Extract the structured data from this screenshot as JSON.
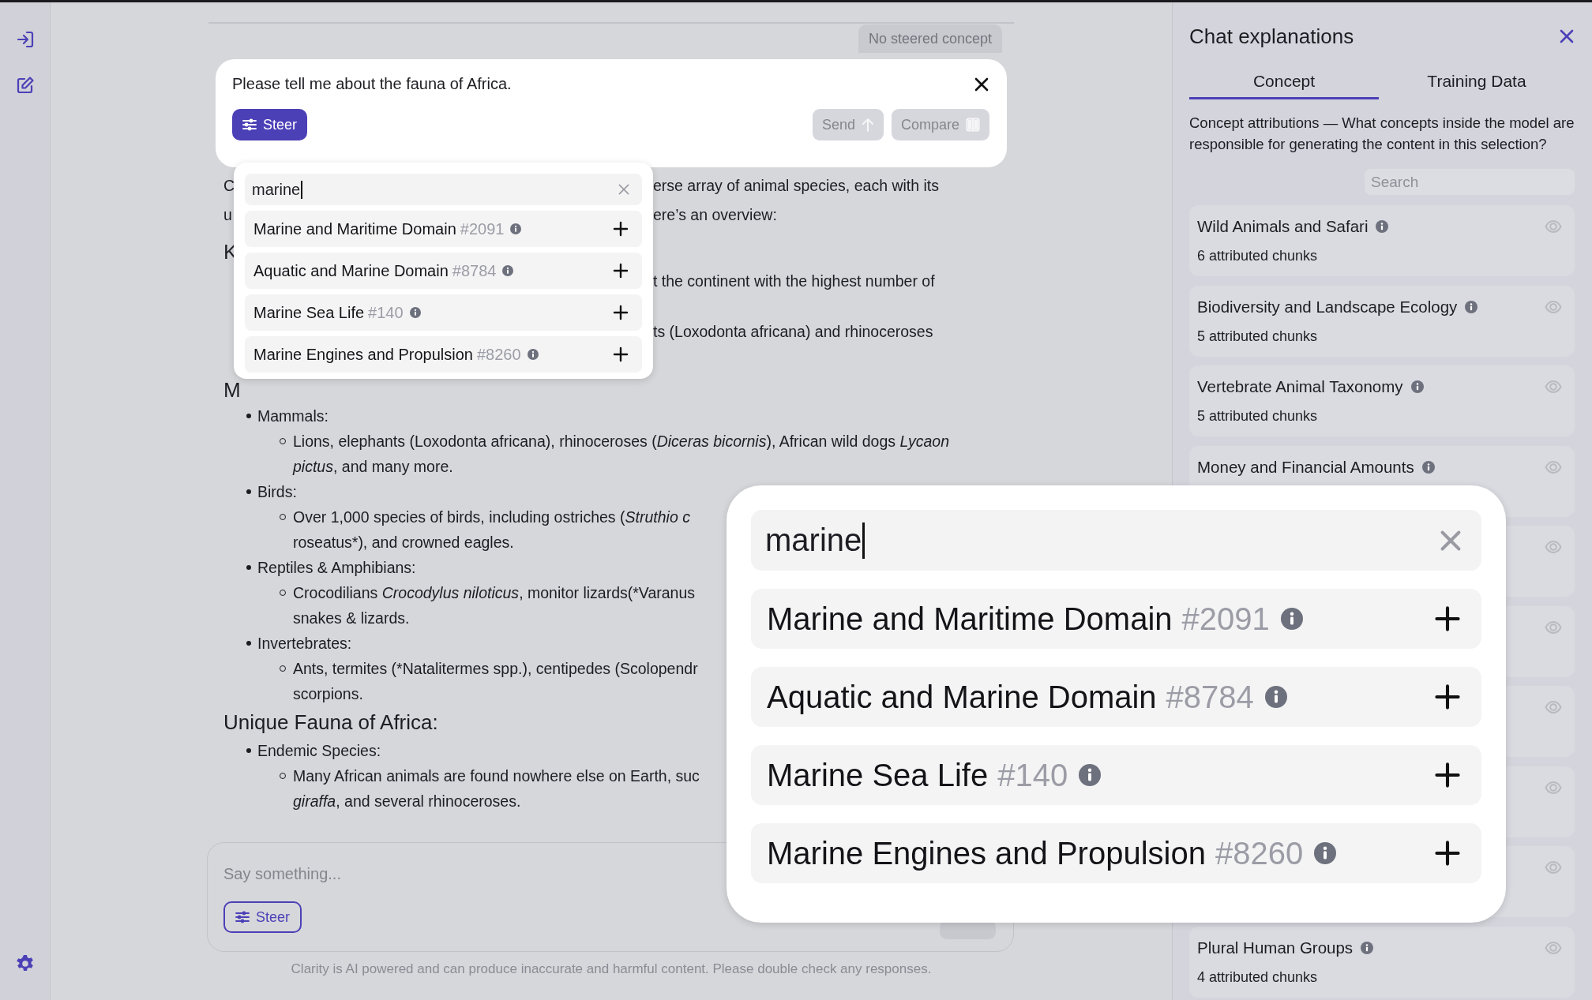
{
  "chat": {
    "steer_status": "No steered concept",
    "prompt": {
      "text": "Please tell me about the fauna of Africa.",
      "steer": {
        "label": "Steer",
        "active": true
      },
      "buttons": [
        {
          "label": "Send",
          "kind": "send",
          "disabled": true
        },
        {
          "label": "Compare",
          "kind": "compare",
          "disabled": true
        }
      ]
    },
    "steer_menu": {
      "query": "marine",
      "results": [
        {
          "name": "Marine and Maritime Domain",
          "id": "#2091"
        },
        {
          "name": "Aquatic and Marine Domain",
          "id": "#8784"
        },
        {
          "name": "Marine Sea Life",
          "id": "#140"
        },
        {
          "name": "Marine Engines and Propulsion",
          "id": "#8260"
        }
      ]
    },
    "response": {
      "fragments": [
        {
          "kind": "text",
          "left": "C",
          "right": "erse array of animal species, each with its"
        },
        {
          "kind": "text",
          "left": "u",
          "right": "ere’s an overview:"
        },
        {
          "kind": "heading",
          "left": "K"
        },
        {
          "kind": "text",
          "right": "t the continent with the highest number of"
        },
        {
          "kind": "text",
          "right": "ts (Loxodonta africana) and rhinoceroses"
        },
        {
          "kind": "heading",
          "left": "M"
        }
      ],
      "sections": [
        {
          "items": [
            {
              "label": "Mammals:",
              "subs": [
                {
                  "lines": [
                    [
                      {
                        "t": "Lions, elephants (Loxodonta africana), rhinoceroses ("
                      },
                      {
                        "t": "Diceras bicornis",
                        "italic": true
                      },
                      {
                        "t": "), African wild dogs "
                      },
                      {
                        "t": "Lycaon",
                        "italic": true
                      }
                    ],
                    [
                      {
                        "t": "pictus",
                        "italic": true
                      },
                      {
                        "t": ", and many more."
                      }
                    ]
                  ]
                }
              ]
            },
            {
              "label": "Birds:",
              "subs": [
                {
                  "lines": [
                    [
                      {
                        "t": "Over 1,000 species of birds, including ostriches ("
                      },
                      {
                        "t": "Struthio c",
                        "italic": true
                      }
                    ],
                    [
                      {
                        "t": "roseatus*), and crowned eagles."
                      }
                    ]
                  ]
                }
              ]
            },
            {
              "label": "Reptiles & Amphibians:",
              "subs": [
                {
                  "lines": [
                    [
                      {
                        "t": "Crocodilians "
                      },
                      {
                        "t": "Crocodylus niloticus",
                        "italic": true
                      },
                      {
                        "t": ", monitor lizards(*Varanus"
                      }
                    ],
                    [
                      {
                        "t": "snakes & lizards."
                      }
                    ]
                  ]
                }
              ]
            },
            {
              "label": "Invertebrates:",
              "subs": [
                {
                  "lines": [
                    [
                      {
                        "t": "Ants, termites (*Natalitermes spp.), centipedes (Scolopendr"
                      }
                    ],
                    [
                      {
                        "t": "scorpions."
                      }
                    ]
                  ]
                }
              ]
            }
          ]
        },
        {
          "heading": "Unique Fauna of Africa:",
          "items": [
            {
              "label": "Endemic Species:",
              "subs": [
                {
                  "lines": [
                    [
                      {
                        "t": "Many African animals are found nowhere else on Earth, suc"
                      }
                    ],
                    [
                      {
                        "t": "giraffa",
                        "italic": true
                      },
                      {
                        "t": ", and several rhinoceroses."
                      }
                    ]
                  ]
                }
              ]
            }
          ]
        }
      ]
    },
    "composer": {
      "placeholder": "Say something...",
      "steer": {
        "label": "Steer",
        "active": false
      }
    },
    "disclaimer": "Clarity is AI powered and can produce inaccurate and harmful content. Please double check any responses."
  },
  "zoomed_steer_menu": {
    "query": "marine",
    "results": [
      {
        "name": "Marine and Maritime Domain",
        "id": "#2091"
      },
      {
        "name": "Aquatic and Marine Domain",
        "id": "#8784"
      },
      {
        "name": "Marine Sea Life",
        "id": "#140"
      },
      {
        "name": "Marine Engines and Propulsion",
        "id": "#8260"
      }
    ]
  },
  "panel": {
    "title": "Chat explanations",
    "tabs": [
      {
        "label": "Concept",
        "selected": true
      },
      {
        "label": "Training Data",
        "selected": false
      }
    ],
    "description": "Concept attributions — What concepts inside the model are responsible for generating the content in this selection?",
    "search": {
      "placeholder": "Search"
    },
    "concepts": [
      {
        "kind": "concept",
        "name": "Wild Animals and Safari",
        "chunks": "6 attributed chunks"
      },
      {
        "kind": "concept",
        "name": "Biodiversity and Landscape Ecology",
        "chunks": "5 attributed chunks"
      },
      {
        "kind": "concept",
        "name": "Vertebrate Animal Taxonomy",
        "chunks": "5 attributed chunks"
      },
      {
        "kind": "concept",
        "name": "Money and Financial Amounts"
      },
      {
        "kind": "covered"
      },
      {
        "kind": "covered"
      },
      {
        "kind": "covered"
      },
      {
        "kind": "covered"
      },
      {
        "kind": "covered"
      },
      {
        "kind": "concept",
        "name": "Plural Human Groups",
        "chunks": "4 attributed chunks"
      }
    ]
  }
}
